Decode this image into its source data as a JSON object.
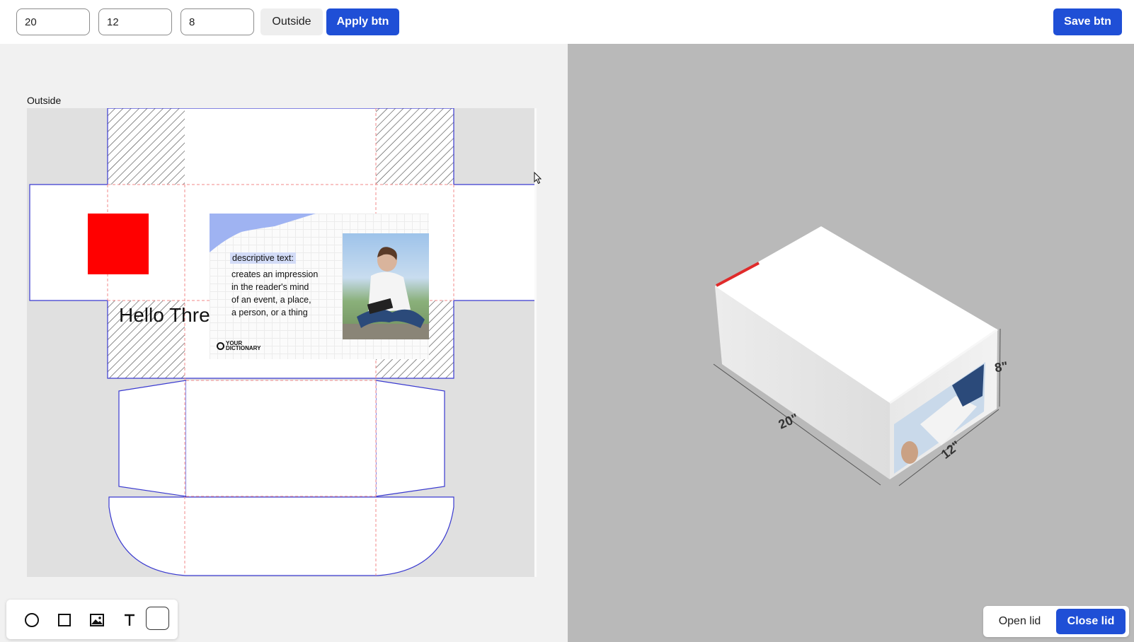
{
  "toolbar": {
    "width_value": "20",
    "depth_value": "12",
    "height_value": "8",
    "side_label": "Outside",
    "apply_label": "Apply btn",
    "save_label": "Save btn"
  },
  "editor": {
    "canvas_label": "Outside",
    "hello_text": "Hello Thre",
    "card": {
      "heading": "descriptive text:",
      "lines": [
        "creates an impression",
        "in the reader's mind",
        "of an event, a place,",
        "a person, or a thing"
      ],
      "logo_line1": "YOUR",
      "logo_line2": "DICTIONARY"
    },
    "tools": [
      "circle-tool-icon",
      "rectangle-tool-icon",
      "image-tool-icon",
      "text-tool-icon",
      "color-swatch"
    ]
  },
  "preview": {
    "dim_width": "20\"",
    "dim_depth": "12\"",
    "dim_height": "8\"",
    "open_lid_label": "Open lid",
    "close_lid_label": "Close lid"
  },
  "colors": {
    "accent": "#1f4fd6",
    "dieline": "#3a3ad0",
    "fold_line": "#f08a8a",
    "red_square": "#ff0000",
    "preview_bg": "#b9b9b9"
  }
}
